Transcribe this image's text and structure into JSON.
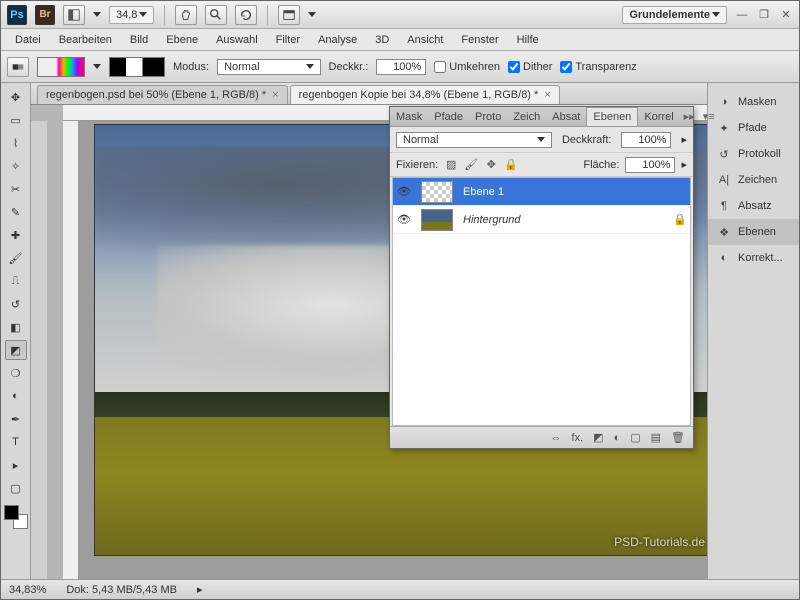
{
  "topbar": {
    "zoom": "34,8",
    "workspace": "Grundelemente"
  },
  "menu": {
    "file": "Datei",
    "edit": "Bearbeiten",
    "image": "Bild",
    "layer": "Ebene",
    "select": "Auswahl",
    "filter": "Filter",
    "analysis": "Analyse",
    "threeD": "3D",
    "view": "Ansicht",
    "window": "Fenster",
    "help": "Hilfe"
  },
  "optbar": {
    "mode_label": "Modus:",
    "mode_value": "Normal",
    "opacity_label": "Deckkr.:",
    "opacity_value": "100%",
    "reverse_label": "Umkehren",
    "dither_label": "Dither",
    "transparency_label": "Transparenz"
  },
  "tabs": {
    "t1": "regenbogen.psd bei 50% (Ebene 1, RGB/8) *",
    "t2": "regenbogen Kopie bei 34,8% (Ebene 1, RGB/8) *"
  },
  "rightpanel": {
    "masks": "Masken",
    "paths": "Pfade",
    "protocol": "Protokoll",
    "character": "Zeichen",
    "paragraph": "Absatz",
    "layers": "Ebenen",
    "corrections": "Korrekt..."
  },
  "layerspanel": {
    "tabs": {
      "mask": "Mask",
      "paths": "Pfade",
      "proto": "Proto",
      "char": "Zeich",
      "para": "Absat",
      "layers": "Ebenen",
      "korr": "Korrel"
    },
    "blend_value": "Normal",
    "opacity_label": "Deckkraft:",
    "opacity_value": "100%",
    "fix_label": "Fixieren:",
    "fill_label": "Fläche:",
    "fill_value": "100%",
    "layers": [
      {
        "name": "Ebene 1",
        "selected": true,
        "locked": false
      },
      {
        "name": "Hintergrund",
        "selected": false,
        "locked": true
      }
    ]
  },
  "status": {
    "zoom": "34,83%",
    "doc": "Dok: 5,43 MB/5,43 MB"
  },
  "watermark": "PSD-Tutorials.de"
}
